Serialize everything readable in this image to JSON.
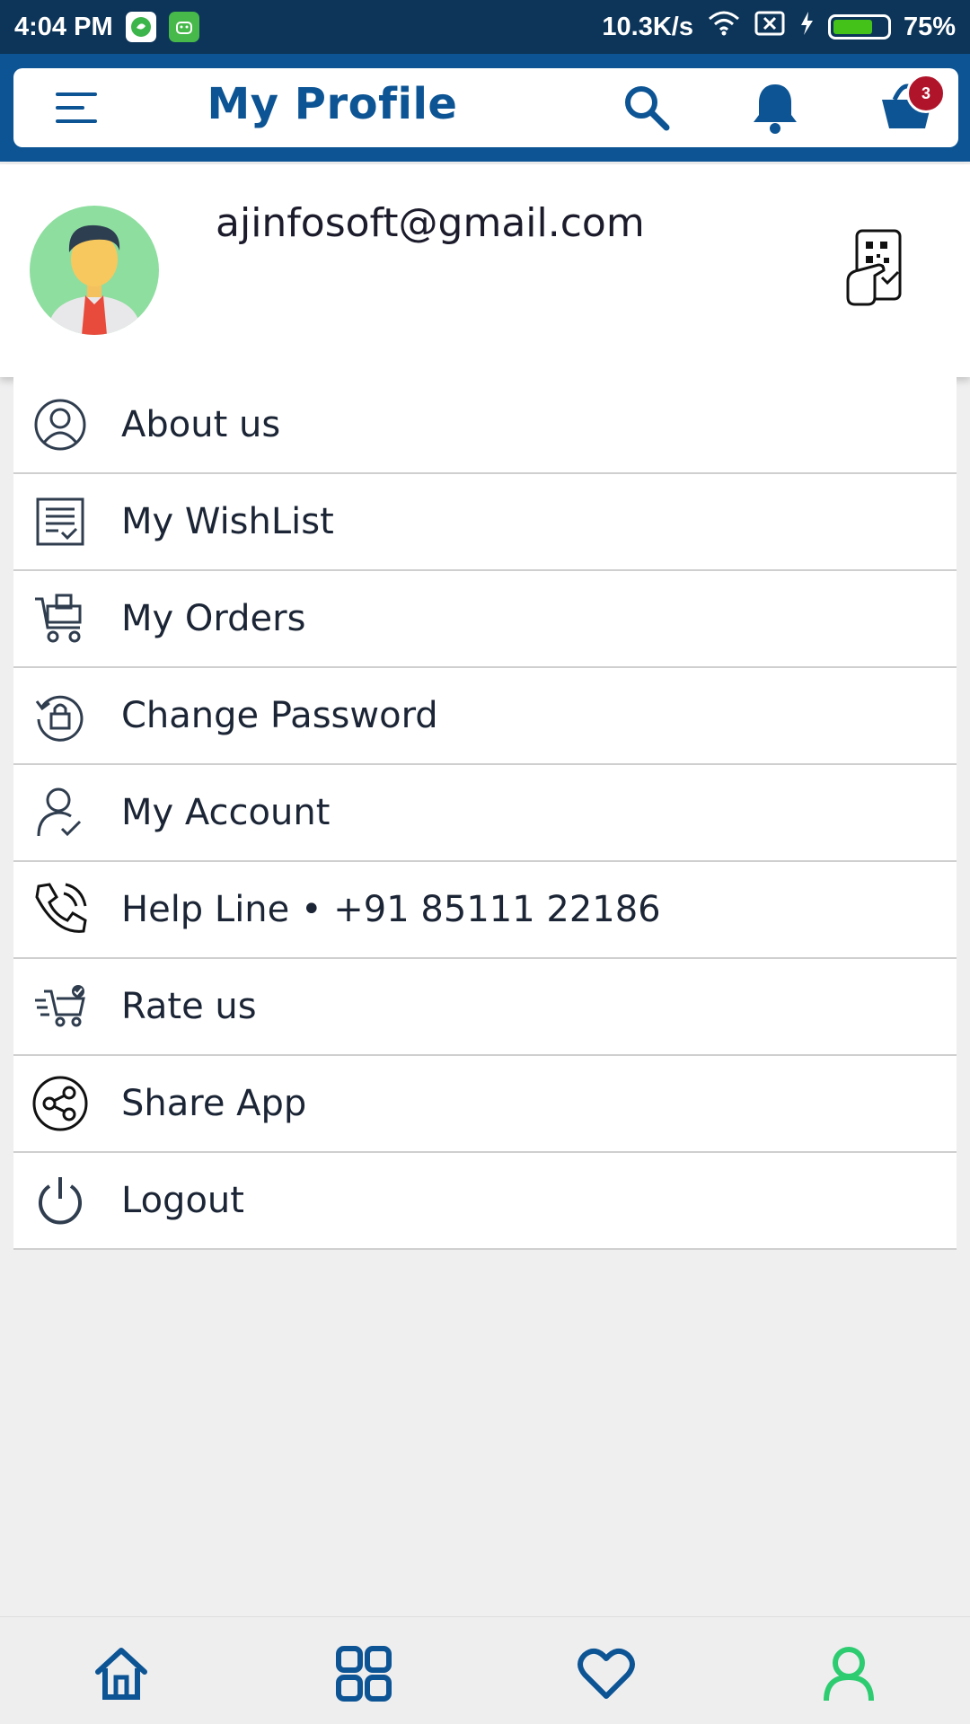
{
  "status_bar": {
    "time": "4:04 PM",
    "speed": "10.3K/s",
    "battery": "75%",
    "battery_level": 0.75,
    "icons": [
      "chat-app-icon",
      "android-app-icon",
      "wifi-icon",
      "no-sim-icon",
      "charging-icon",
      "battery-icon"
    ]
  },
  "header": {
    "title": "My Profile",
    "menu_icon": "hamburger-icon",
    "search_icon": "search-icon",
    "bell_icon": "bell-icon",
    "cart_icon": "basket-icon",
    "cart_count": "3"
  },
  "profile": {
    "email": "ajinfosoft@gmail.com",
    "avatar_icon": "user-avatar",
    "qr_icon": "qr-scan-icon"
  },
  "menu": {
    "items": [
      {
        "label": "About us",
        "icon": "person-circle-icon"
      },
      {
        "label": "My WishList",
        "icon": "list-icon"
      },
      {
        "label": "My Orders",
        "icon": "cart-box-icon"
      },
      {
        "label": "Change Password",
        "icon": "lock-refresh-icon"
      },
      {
        "label": "My Account",
        "icon": "user-check-icon"
      },
      {
        "label": "Help Line • +91 85111 22186",
        "icon": "phone-icon"
      },
      {
        "label": "Rate us",
        "icon": "fast-cart-icon"
      },
      {
        "label": "Share App",
        "icon": "share-icon"
      },
      {
        "label": "Logout",
        "icon": "power-icon"
      }
    ]
  },
  "bottom_nav": {
    "items": [
      "home-icon",
      "grid-icon",
      "heart-icon",
      "profile-icon"
    ],
    "active": "profile-icon"
  },
  "colors": {
    "primary": "#0c5494",
    "status_bar": "#0c3559",
    "badge": "#b0142a",
    "active_nav": "#2ecc71"
  }
}
